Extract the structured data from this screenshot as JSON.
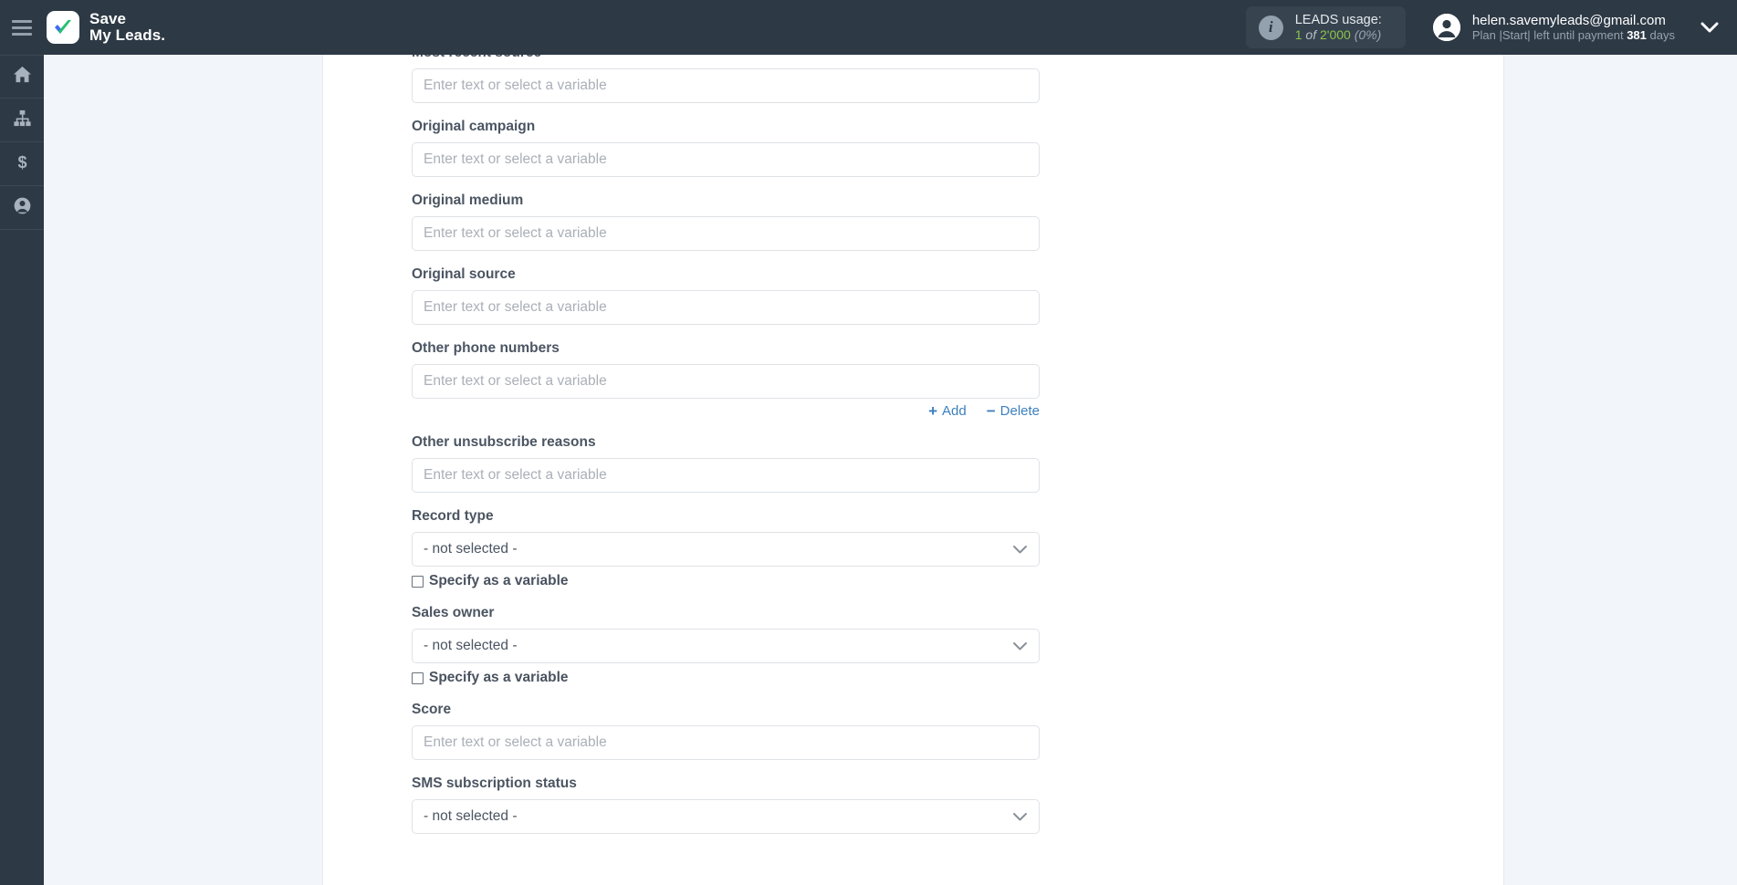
{
  "topbar": {
    "menu_icon": "hamburger-icon",
    "brand_line1": "Save",
    "brand_line2": "My Leads.",
    "logo_icon": "checkmark-logo-icon",
    "usage": {
      "info_icon": "info-icon",
      "title": "LEADS usage:",
      "used": "1",
      "of": "of",
      "total": "2'000",
      "percent": "(0%)"
    },
    "account": {
      "avatar_icon": "user-avatar-icon",
      "email": "helen.savemyleads@gmail.com",
      "plan_prefix": "Plan |Start| left until payment",
      "plan_days": "381",
      "plan_suffix": "days",
      "caret_icon": "chevron-down-icon"
    }
  },
  "sidebar": {
    "items": [
      {
        "icon": "home-icon",
        "name": "home"
      },
      {
        "icon": "sitemap-icon",
        "name": "connections"
      },
      {
        "icon": "dollar-icon",
        "name": "billing"
      },
      {
        "icon": "user-icon",
        "name": "profile"
      }
    ]
  },
  "form": {
    "placeholder": "Enter text or select a variable",
    "not_selected": "- not selected -",
    "add_label": "Add",
    "add_sign": "+",
    "delete_label": "Delete",
    "delete_sign": "−",
    "specify_variable_label": "Specify as a variable",
    "fields": [
      {
        "label": "Most recent source",
        "type": "text"
      },
      {
        "label": "Original campaign",
        "type": "text"
      },
      {
        "label": "Original medium",
        "type": "text"
      },
      {
        "label": "Original source",
        "type": "text"
      },
      {
        "label": "Other phone numbers",
        "type": "text",
        "actions": true
      },
      {
        "label": "Other unsubscribe reasons",
        "type": "text"
      },
      {
        "label": "Record type",
        "type": "select",
        "checkbox": true
      },
      {
        "label": "Sales owner",
        "type": "select",
        "checkbox": true
      },
      {
        "label": "Score",
        "type": "text"
      },
      {
        "label": "SMS subscription status",
        "type": "select"
      }
    ]
  }
}
